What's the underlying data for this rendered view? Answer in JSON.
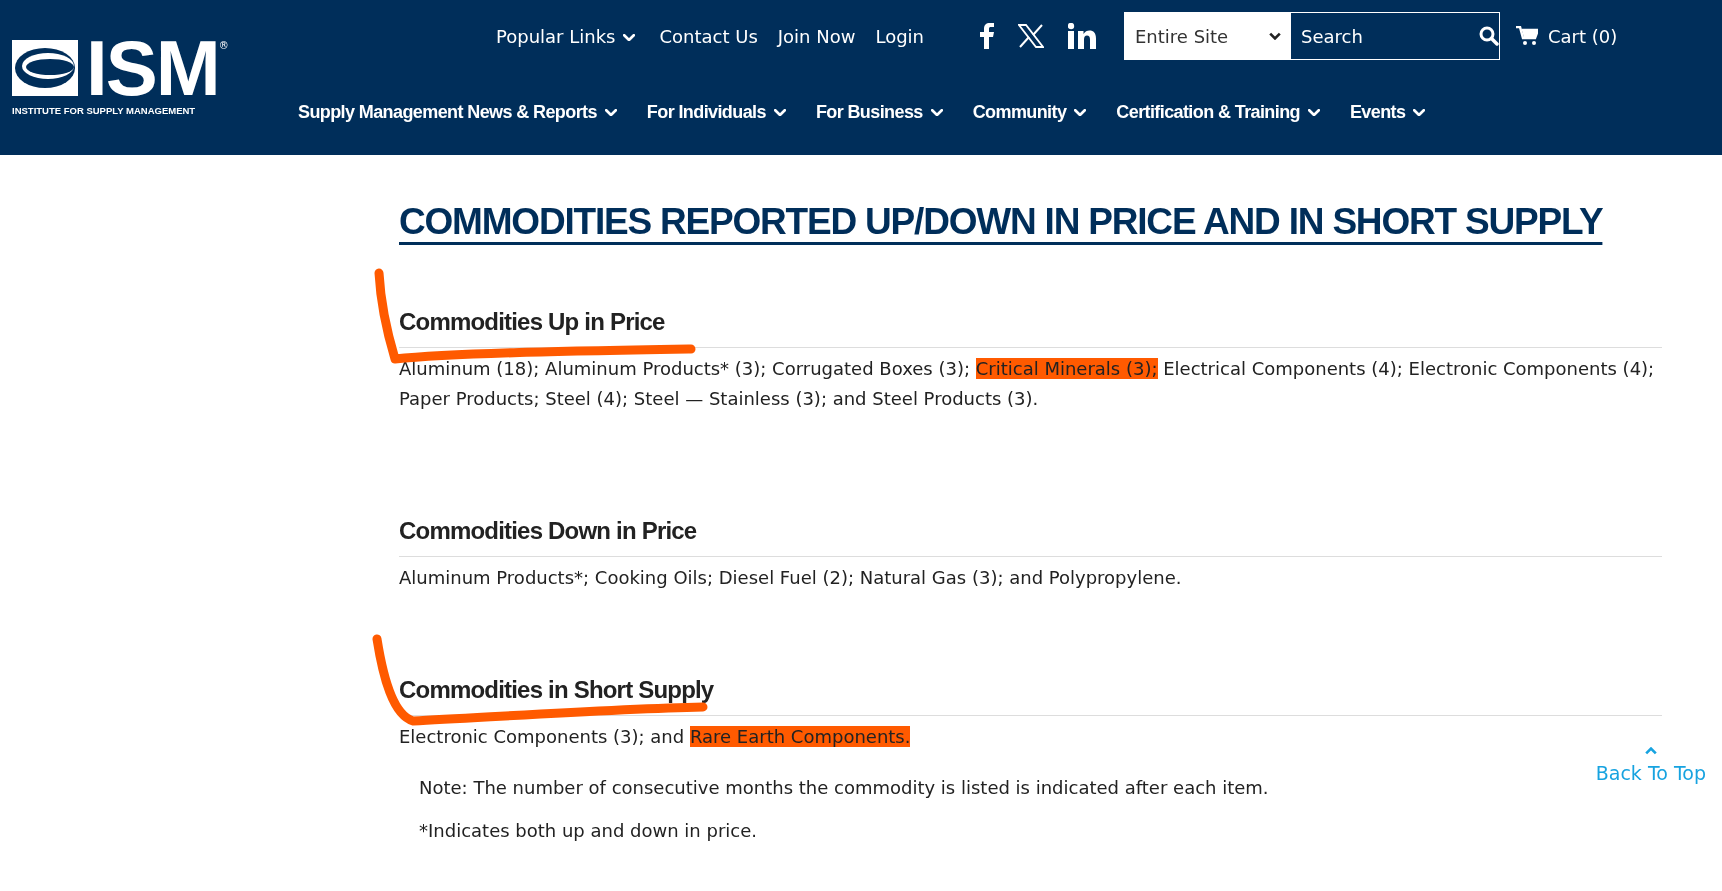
{
  "logo": {
    "name": "ISM",
    "registered": "®",
    "tagline": "INSTITUTE FOR SUPPLY MANAGEMENT"
  },
  "top_links": [
    {
      "label": "Popular Links",
      "dropdown": true
    },
    {
      "label": "Contact Us",
      "dropdown": false
    },
    {
      "label": "Join Now",
      "dropdown": false
    },
    {
      "label": "Login",
      "dropdown": false
    }
  ],
  "search": {
    "scope": "Entire Site",
    "placeholder": "Search"
  },
  "cart": {
    "label": "Cart (0)"
  },
  "main_nav": [
    {
      "label": "Supply Management News & Reports"
    },
    {
      "label": "For Individuals"
    },
    {
      "label": "For Business"
    },
    {
      "label": "Community"
    },
    {
      "label": "Certification & Training"
    },
    {
      "label": "Events"
    }
  ],
  "page_title": "COMMODITIES REPORTED UP/DOWN IN PRICE AND IN SHORT SUPPLY",
  "sections": [
    {
      "heading": "Commodities Up in Price",
      "annotated": true,
      "segments": [
        {
          "text": "Aluminum (18); Aluminum Products* (3); Corrugated Boxes (3); ",
          "highlighted": false
        },
        {
          "text": "Critical Minerals (3);",
          "highlighted": true
        },
        {
          "text": " Electrical Components (4); Electronic Components (4); Paper Products; Steel (4); Steel — Stainless (3); and Steel Products (3).",
          "highlighted": false
        }
      ]
    },
    {
      "heading": "Commodities Down in Price",
      "annotated": false,
      "segments": [
        {
          "text": "Aluminum Products*; Cooking Oils; Diesel Fuel (2); Natural Gas (3); and Polypropylene.",
          "highlighted": false
        }
      ]
    },
    {
      "heading": "Commodities in Short Supply",
      "annotated": true,
      "segments": [
        {
          "text": "Electronic Components (3); and ",
          "highlighted": false
        },
        {
          "text": "Rare Earth Components.",
          "highlighted": true
        }
      ]
    }
  ],
  "notes": [
    "Note: The number of consecutive months the commodity is listed is indicated after each item.",
    "*Indicates both up and down in price."
  ],
  "back_to_top": "Back To Top"
}
